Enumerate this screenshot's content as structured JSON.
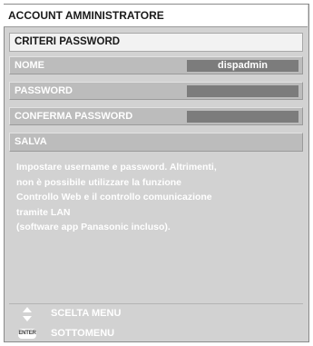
{
  "window": {
    "title": "ACCOUNT AMMINISTRATORE"
  },
  "tab": {
    "label": "CRITERI PASSWORD"
  },
  "fields": {
    "nome": {
      "label": "NOME",
      "value": "dispadmin"
    },
    "password": {
      "label": "PASSWORD",
      "value": ""
    },
    "conferma": {
      "label": "CONFERMA PASSWORD",
      "value": ""
    },
    "salva": {
      "label": "SALVA"
    }
  },
  "message": {
    "lines": [
      "Impostare username e password. Altrimenti,",
      "non è possibile utilizzare la funzione",
      "Controllo Web e il controllo comunicazione",
      "tramite LAN",
      "(software app Panasonic incluso)."
    ]
  },
  "hints": {
    "menu": {
      "icon": "up-down-arrows-icon",
      "label": "SCELTA MENU"
    },
    "enter": {
      "icon": "enter-key-icon",
      "badge": "ENTER",
      "label": "SOTTOMENU"
    }
  },
  "colors": {
    "panel": "#d2d2d2",
    "row": "#bcbcbc",
    "value_box": "#7c7c7c",
    "text_light": "#ffffff"
  }
}
